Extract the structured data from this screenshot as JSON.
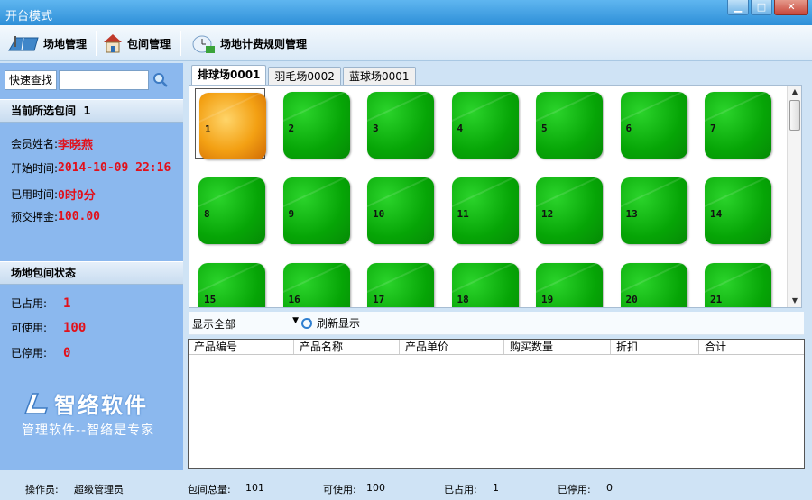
{
  "window": {
    "title": "开台模式",
    "min": "▁",
    "max": "□",
    "close": "✕"
  },
  "toolbar": {
    "venue_mgmt": "场地管理",
    "room_mgmt": "包间管理",
    "billing_rules": "场地计费规则管理"
  },
  "search": {
    "label": "快速查找",
    "value": ""
  },
  "current": {
    "header_label": "当前所选包间",
    "room_no": "1",
    "member_label": "会员姓名:",
    "member_name": "李晓燕",
    "start_label": "开始时间:",
    "start_time": "2014-10-09 22:16",
    "used_label": "已用时间:",
    "used_time": "0时0分",
    "deposit_label": "预交押金:",
    "deposit": "100.00"
  },
  "status_section": {
    "header": "场地包间状态",
    "occupied_label": "已占用:",
    "occupied": "1",
    "available_label": "可使用:",
    "available": "100",
    "disabled_label": "已停用:",
    "disabled": "0"
  },
  "logo": {
    "brand": "智络软件",
    "slogan": "管理软件--智络是专家"
  },
  "tabs": [
    {
      "label": "排球场0001",
      "active": true
    },
    {
      "label": "羽毛场0002",
      "active": false
    },
    {
      "label": "蓝球场0001",
      "active": false
    }
  ],
  "rooms": [
    {
      "n": "1",
      "status": "occupied"
    },
    {
      "n": "2",
      "status": "free"
    },
    {
      "n": "3",
      "status": "free"
    },
    {
      "n": "4",
      "status": "free"
    },
    {
      "n": "5",
      "status": "free"
    },
    {
      "n": "6",
      "status": "free"
    },
    {
      "n": "7",
      "status": "free"
    },
    {
      "n": "8",
      "status": "free"
    },
    {
      "n": "9",
      "status": "free"
    },
    {
      "n": "10",
      "status": "free"
    },
    {
      "n": "11",
      "status": "free"
    },
    {
      "n": "12",
      "status": "free"
    },
    {
      "n": "13",
      "status": "free"
    },
    {
      "n": "14",
      "status": "free"
    },
    {
      "n": "15",
      "status": "free"
    },
    {
      "n": "16",
      "status": "free"
    },
    {
      "n": "17",
      "status": "free"
    },
    {
      "n": "18",
      "status": "free"
    },
    {
      "n": "19",
      "status": "free"
    },
    {
      "n": "20",
      "status": "free"
    },
    {
      "n": "21",
      "status": "free"
    }
  ],
  "filter": {
    "selected": "显示全部",
    "refresh": "刷新显示"
  },
  "table": {
    "columns": [
      "产品编号",
      "产品名称",
      "产品单价",
      "购买数量",
      "折扣",
      "合计"
    ]
  },
  "statusbar": {
    "operator_label": "操作员:",
    "operator": "超级管理员",
    "total_label": "包间总量:",
    "total": "101",
    "available_label": "可使用:",
    "available": "100",
    "occupied_label": "已占用:",
    "occupied": "1",
    "disabled_label": "已停用:",
    "disabled": "0"
  },
  "colors": {
    "accent": "#2e8fd8",
    "panel": "#8bb8ee",
    "free": "#06a506",
    "occupied": "#f3a013",
    "value_red": "#e2101a"
  }
}
